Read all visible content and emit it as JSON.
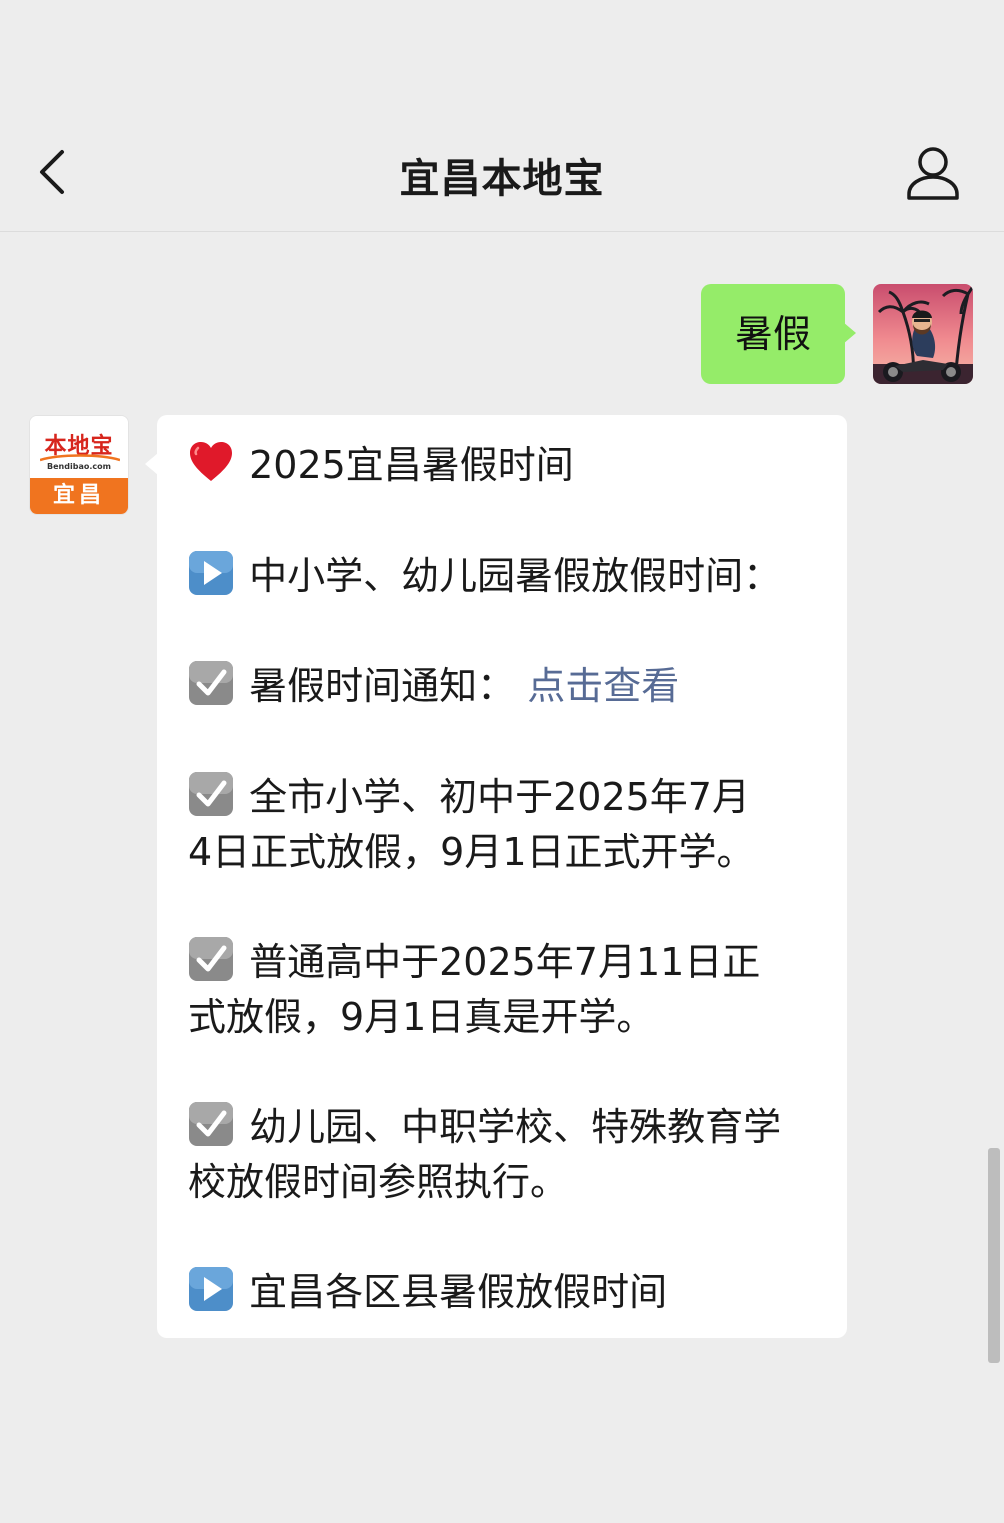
{
  "navbar": {
    "title": "宜昌本地宝",
    "back_icon": "chevron-left-icon",
    "profile_icon": "person-icon"
  },
  "sent_message": {
    "text": "暑假",
    "bubble_color": "#95ec69"
  },
  "bot": {
    "avatar_logo_text": "本地宝",
    "avatar_domain": "Bendibao.com",
    "avatar_city": "宜昌",
    "brand_color": "#f0741f"
  },
  "reply": {
    "title": "2025宜昌暑假时间",
    "section1": "中小学、幼儿园暑假放假时间：",
    "notice_label": "暑假时间通知：",
    "notice_link": "点击查看",
    "item1_line1": "全市小学、初中于2025年7月",
    "item1_line2": "4日正式放假，9月1日正式开学。",
    "item2_line1": "普通高中于2025年7月11日正",
    "item2_line2": "式放假，9月1日真是开学。",
    "item3_line1": "幼儿园、中职学校、特殊教育学",
    "item3_line2": "校放假时间参照执行。",
    "section2": "宜昌各区县暑假放假时间",
    "link_color": "#576b95"
  },
  "icons": {
    "heart": "red-heart-icon",
    "play": "play-button-icon",
    "check": "check-box-icon"
  }
}
